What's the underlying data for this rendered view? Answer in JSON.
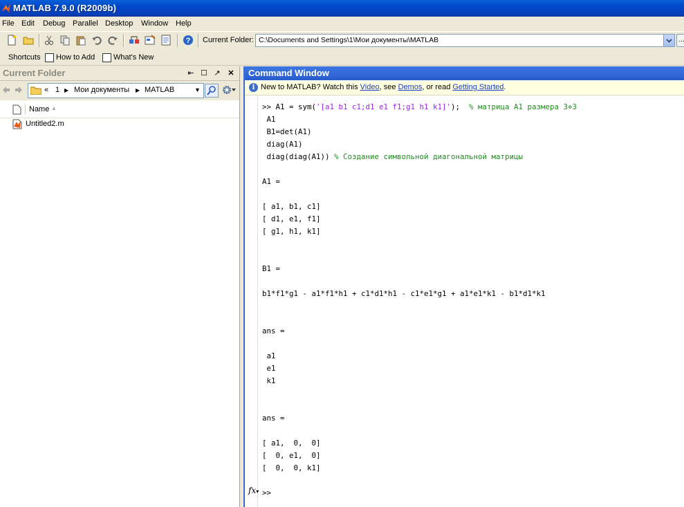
{
  "window": {
    "title": "MATLAB  7.9.0 (R2009b)"
  },
  "menu": [
    "File",
    "Edit",
    "Debug",
    "Parallel",
    "Desktop",
    "Window",
    "Help"
  ],
  "toolbar": {
    "current_folder_label": "Current Folder:",
    "current_folder_path": "C:\\Documents and Settings\\1\\Мои документы\\MATLAB",
    "browse_label": "..."
  },
  "shortcuts": {
    "label": "Shortcuts",
    "how_to_add": "How to Add",
    "whats_new": "What's New"
  },
  "current_folder": {
    "title": "Current Folder",
    "breadcrumb": [
      "«",
      "1",
      "Мои документы",
      "MATLAB"
    ],
    "column_name": "Name",
    "files": [
      {
        "name": "Untitled2.m"
      }
    ]
  },
  "command_window": {
    "title": "Command Window",
    "info": {
      "pre": "New to MATLAB? Watch this ",
      "link_video": "Video",
      "mid1": ", see ",
      "link_demos": "Demos",
      "mid2": ", or read ",
      "link_getting_started": "Getting Started",
      "post": "."
    },
    "lines": [
      [
        {
          "t": ">> A1 = sym("
        },
        {
          "t": "'[a1 b1 c1;d1 e1 f1;g1 h1 k1]'",
          "c": "str"
        },
        {
          "t": ");  "
        },
        {
          "t": "% матрица A1 размера 3⋄3",
          "c": "cmt"
        }
      ],
      [
        {
          "t": " A1"
        }
      ],
      [
        {
          "t": " B1=det(A1)"
        }
      ],
      [
        {
          "t": " diag(A1)"
        }
      ],
      [
        {
          "t": " diag(diag(A1)) "
        },
        {
          "t": "% Создание символьной диагональной матрицы",
          "c": "cmt"
        }
      ],
      [],
      [
        {
          "t": "A1 ="
        }
      ],
      [],
      [
        {
          "t": "[ a1, b1, c1]"
        }
      ],
      [
        {
          "t": "[ d1, e1, f1]"
        }
      ],
      [
        {
          "t": "[ g1, h1, k1]"
        }
      ],
      [],
      [],
      [
        {
          "t": "B1 ="
        }
      ],
      [],
      [
        {
          "t": "b1*f1*g1 - a1*f1*h1 + c1*d1*h1 - c1*e1*g1 + a1*e1*k1 - b1*d1*k1"
        }
      ],
      [],
      [],
      [
        {
          "t": "ans ="
        }
      ],
      [],
      [
        {
          "t": " a1"
        }
      ],
      [
        {
          "t": " e1"
        }
      ],
      [
        {
          "t": " k1"
        }
      ],
      [],
      [],
      [
        {
          "t": "ans ="
        }
      ],
      [],
      [
        {
          "t": "[ a1,  0,  0]"
        }
      ],
      [
        {
          "t": "[  0, e1,  0]"
        }
      ],
      [
        {
          "t": "[  0,  0, k1]"
        }
      ],
      [],
      [
        {
          "t": ">> "
        }
      ]
    ],
    "fx_label": "fx"
  }
}
